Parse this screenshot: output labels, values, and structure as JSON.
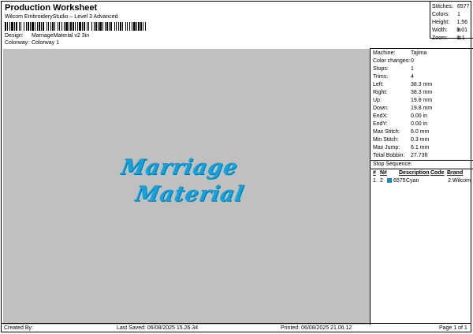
{
  "header": {
    "title": "Production Worksheet",
    "subtitle": "Wilcom EmbroideryStudio – Level 3 Advanced",
    "design_label": "Design:",
    "design_value": "MarriageMaterial v2 3in",
    "colorway_label": "Colorway:",
    "colorway_value": "Colorway 1"
  },
  "topstats": [
    {
      "label": "Stitches:",
      "value": "6577"
    },
    {
      "label": "Colors:",
      "value": "1"
    },
    {
      "label": "Height:",
      "value": "1.56 in"
    },
    {
      "label": "Width:",
      "value": "3.01 in"
    },
    {
      "label": "Zoom:",
      "value": "1:1"
    }
  ],
  "design_text": {
    "line1": "Marriage",
    "line2": "Material"
  },
  "machine_stats": [
    {
      "label": "Machine:",
      "value": "Tajima"
    },
    {
      "label": "Color changes:",
      "value": "0"
    },
    {
      "label": "Stops:",
      "value": "1"
    },
    {
      "label": "Trims:",
      "value": "4"
    },
    {
      "label": "Left:",
      "value": "38.3 mm"
    },
    {
      "label": "Right:",
      "value": "38.3 mm"
    },
    {
      "label": "Up:",
      "value": "19.8 mm"
    },
    {
      "label": "Down:",
      "value": "19.8 mm"
    },
    {
      "label": "EndX:",
      "value": "0.00 in"
    },
    {
      "label": "EndY:",
      "value": "0.00 in"
    },
    {
      "label": "Max Stitch:",
      "value": "6.0 mm"
    },
    {
      "label": "Min Stitch:",
      "value": "0.3 mm"
    },
    {
      "label": "Max Jump:",
      "value": "6.1 mm"
    },
    {
      "label": "Total Bobbin:",
      "value": "27.73ft"
    }
  ],
  "stop_sequence": {
    "title": "Stop Sequence:",
    "headers": {
      "num": "#",
      "n": "N#",
      "description": "Description",
      "code": "Code",
      "brand": "Brand"
    },
    "rows": [
      {
        "num": "1.",
        "n": "2",
        "color": "#1a8ac6",
        "stitches": "6575",
        "description": "Cyan",
        "code": "2",
        "brand": "Wilcom"
      }
    ]
  },
  "footer": {
    "created_by": "Created By:",
    "last_saved": "Last Saved: 06/08/2025 15.26.34",
    "printed": "Printed: 06/08/2025 21.06.12",
    "page": "Page 1 of 1"
  }
}
